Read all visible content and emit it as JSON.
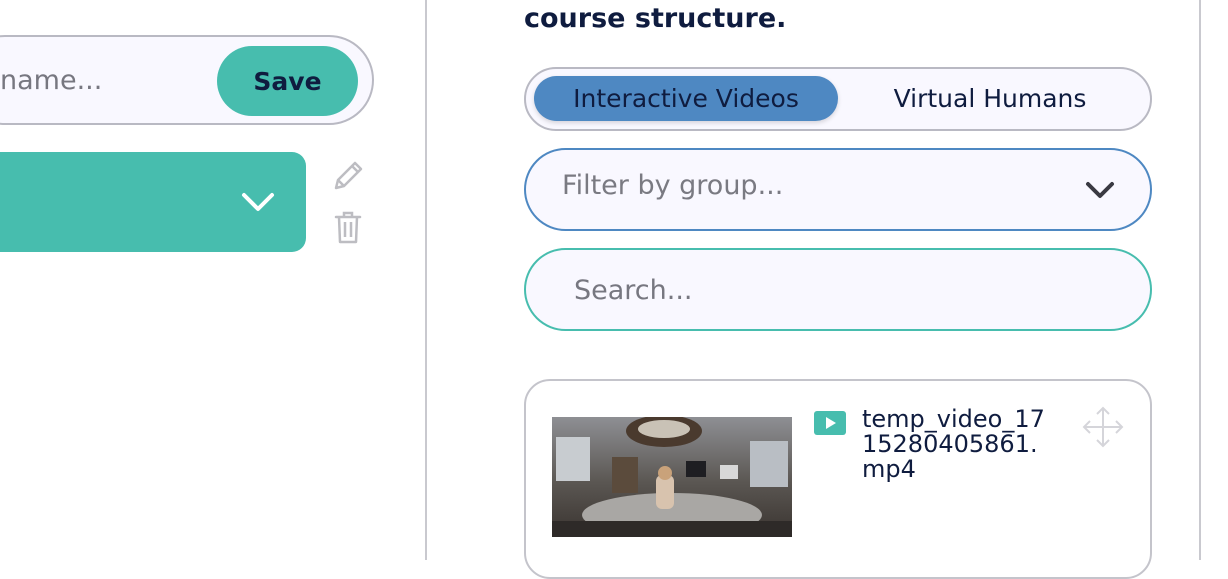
{
  "left_panel": {
    "name_input_placeholder": "name...",
    "save_label": "Save"
  },
  "right_panel": {
    "heading_top_line": "course structure.",
    "tabs": [
      {
        "label": "Interactive Videos",
        "active": true
      },
      {
        "label": "Virtual Humans",
        "active": false
      }
    ],
    "filter_placeholder": "Filter by group...",
    "search_placeholder": "Search...",
    "video_item": {
      "file_name": "temp_video_1715280405861.mp4",
      "type_icon": "play-icon",
      "action_icon": "move-icon"
    }
  },
  "icons": [
    "chevron-down-icon",
    "edit-icon",
    "trash-icon",
    "play-icon",
    "move-icon"
  ],
  "colors": {
    "accent_teal": "#47bdae",
    "active_tab_blue": "#4e88c2",
    "text_dark": "#0f1c3f",
    "placeholder_grey": "#777780"
  }
}
